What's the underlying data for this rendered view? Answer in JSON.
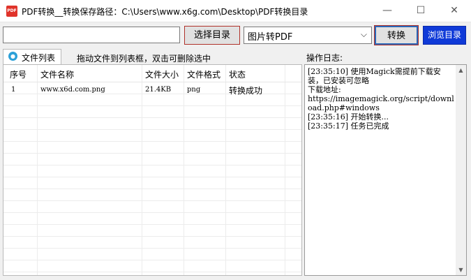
{
  "window": {
    "title": "PDF转换__转换保存路径：C:\\Users\\www.x6g.com\\Desktop\\PDF转换目录",
    "icon_text": "PDF",
    "minimize_glyph": "—",
    "maximize_glyph": "☐",
    "close_glyph": "✕"
  },
  "toolbar": {
    "path_value": "",
    "select_dir_label": "选择目录",
    "format_selected": "图片转PDF",
    "convert_label": "转换",
    "browse_label": "浏览目录"
  },
  "tabs": {
    "file_list_label": "文件列表",
    "hint": "拖动文件到列表框，双击可删除选中"
  },
  "table": {
    "headers": [
      "序号",
      "文件名称",
      "文件大小",
      "文件格式",
      "状态"
    ],
    "rows": [
      [
        "1",
        "www.x6d.com.png",
        "21.4KB",
        "png",
        "转换成功"
      ]
    ]
  },
  "log": {
    "label": "操作日志:",
    "lines": [
      "[23:35:10] 使用Magick需提前下载安装，已安装可忽略",
      "下载地址:",
      "https://imagemagick.org/script/download.php#windows",
      "[23:35:16] 开始转换...",
      "[23:35:17] 任务已完成"
    ]
  },
  "colors": {
    "accent_red_border": "#b0312a",
    "browse_button_bg": "#0f3ad8",
    "convert_button_border": "#2a67b8"
  },
  "icons": {
    "app": "pdf-app-icon",
    "tab": "file-list-icon",
    "dropdown": "chevron-down-icon"
  }
}
